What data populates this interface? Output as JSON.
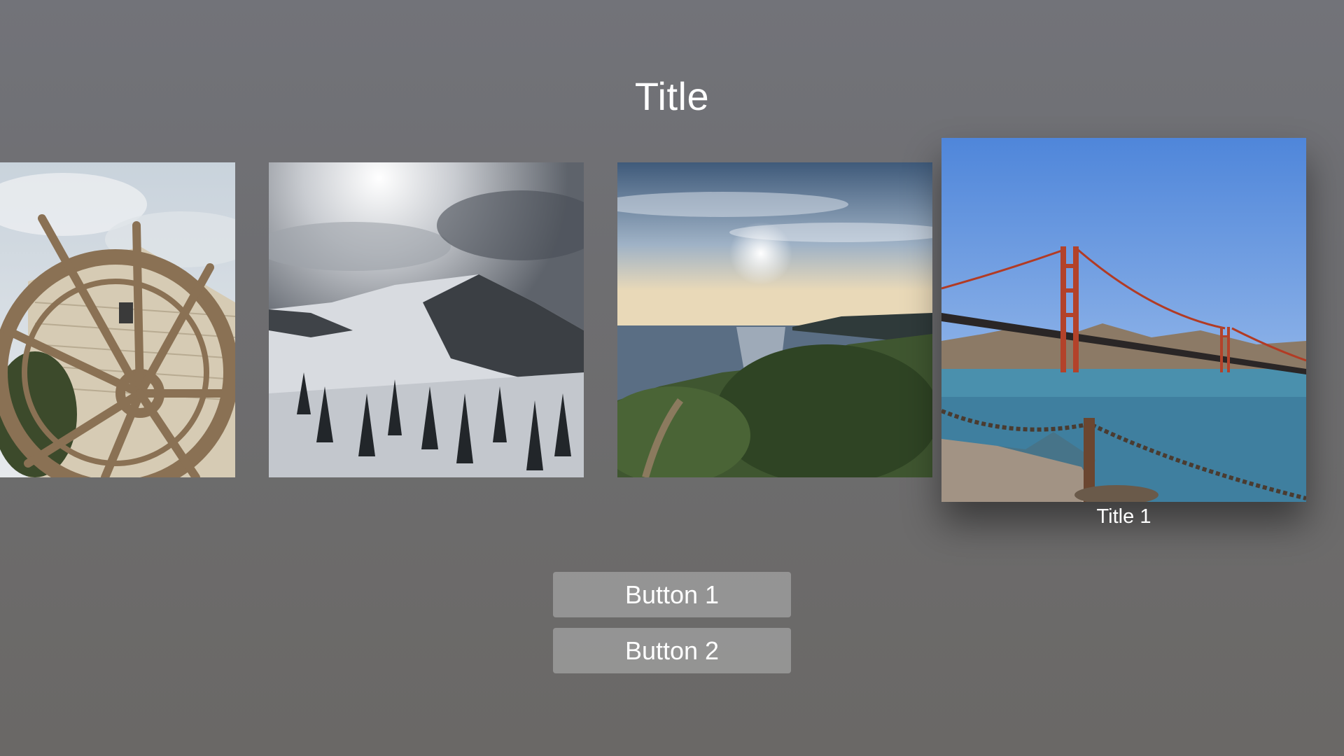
{
  "header": {
    "title": "Title"
  },
  "carousel": {
    "items": [
      {
        "image": "water-wheel-photo"
      },
      {
        "image": "snowy-mountain-photo"
      },
      {
        "image": "coastal-sunset-photo"
      },
      {
        "image": "golden-gate-bridge-photo",
        "caption": "Title 1",
        "focused": true
      }
    ]
  },
  "buttons": [
    {
      "label": "Button 1"
    },
    {
      "label": "Button 2"
    }
  ],
  "colors": {
    "background": "#6e6e71",
    "button_fill": "#afafaf",
    "text": "#ffffff"
  }
}
